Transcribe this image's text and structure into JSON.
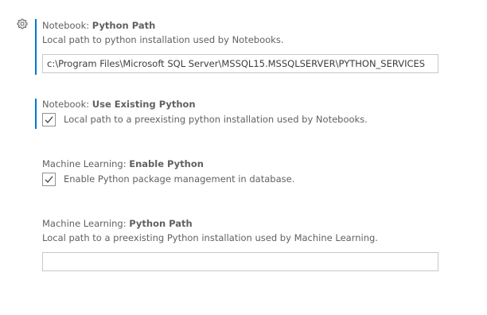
{
  "settings": [
    {
      "category": "Notebook: ",
      "key": "Python Path",
      "description": "Local path to python installation used by Notebooks.",
      "value": "c:\\Program Files\\Microsoft SQL Server\\MSSQL15.MSSQLSERVER\\PYTHON_SERVICES",
      "modified": true
    },
    {
      "category": "Notebook: ",
      "key": "Use Existing Python",
      "checkbox_label": "Local path to a preexisting python installation used by Notebooks.",
      "checked": true,
      "modified": true
    },
    {
      "category": "Machine Learning: ",
      "key": "Enable Python",
      "checkbox_label": "Enable Python package management in database.",
      "checked": true,
      "modified": false
    },
    {
      "category": "Machine Learning: ",
      "key": "Python Path",
      "description": "Local path to a preexisting Python installation used by Machine Learning.",
      "value": "",
      "modified": false
    }
  ],
  "icons": {
    "gear": "gear-icon",
    "check": "check-icon"
  },
  "colors": {
    "modified_indicator": "#0078d4",
    "text": "#616161",
    "input_border": "#c8c8c8"
  }
}
